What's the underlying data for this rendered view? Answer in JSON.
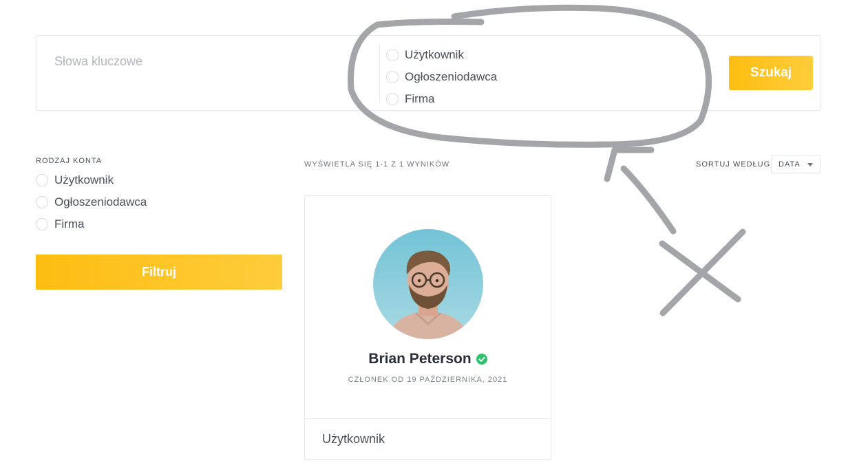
{
  "search": {
    "keywords_placeholder": "Słowa kluczowe",
    "keywords_value": "",
    "account_options": [
      "Użytkownik",
      "Ogłoszeniodawca",
      "Firma"
    ],
    "submit_label": "Szukaj"
  },
  "filter": {
    "heading": "RODZAJ KONTA",
    "options": [
      "Użytkownik",
      "Ogłoszeniodawca",
      "Firma"
    ],
    "submit_label": "Filtruj"
  },
  "results": {
    "count_text": "WYŚWIETLA SIĘ 1-1 Z 1 WYNIKÓW",
    "sort_label": "SORTUJ WEDŁUG",
    "sort_value": "DATA"
  },
  "profiles": [
    {
      "name": "Brian Peterson",
      "verified": true,
      "member_since": "CZŁONEK OD 19 PAŹDZIERNIKA, 2021",
      "account_type": "Użytkownik"
    }
  ],
  "colors": {
    "accent": "#fdbd12",
    "accent_light": "#fecd3b",
    "verified": "#2dc26b",
    "annotation": "#a3a5a9"
  },
  "icons": {
    "verified": "check-circle-icon",
    "sort_caret": "caret-down-icon"
  }
}
